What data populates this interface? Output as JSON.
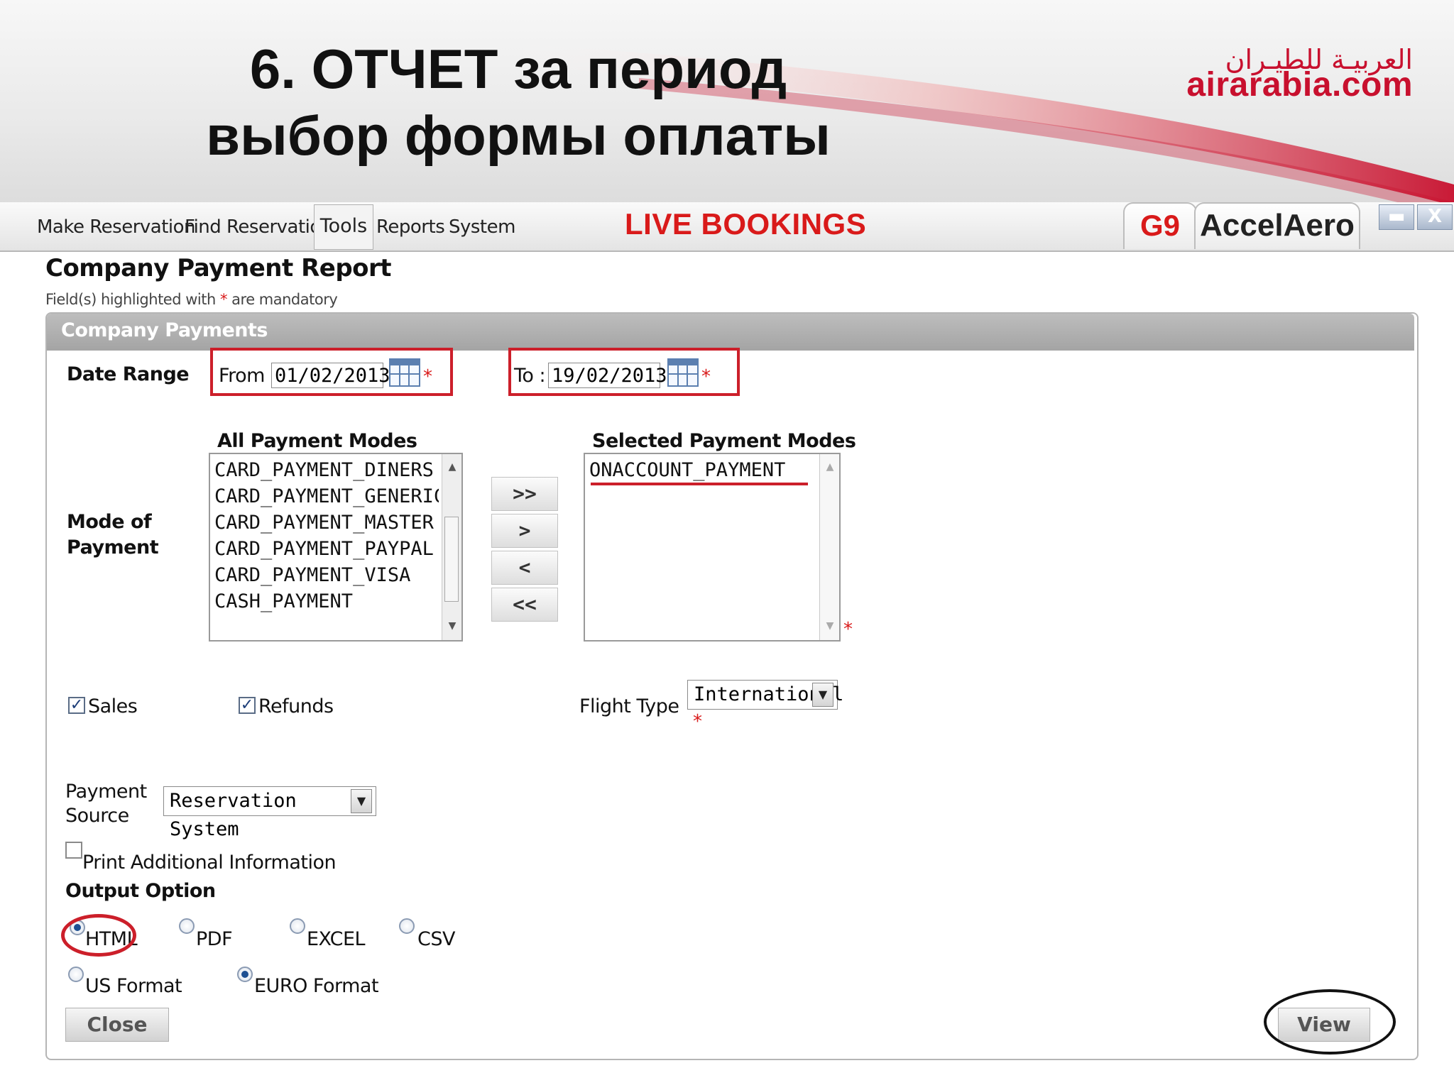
{
  "slide": {
    "title_line1": "6. ОТЧЕТ за период",
    "title_line2": "выбор формы оплаты",
    "logo_arabic": "العربيـة للطيـران",
    "logo_text": "airarabia.com"
  },
  "menu": {
    "items": [
      "Make Reservation",
      "Find Reservation",
      "Tools",
      "Reports",
      "System"
    ],
    "live_label": "LIVE BOOKINGS",
    "brand_tab1": "G9",
    "brand_tab2": "AccelAero",
    "minimize_label": "▬",
    "close_label": "X"
  },
  "page": {
    "title": "Company Payment Report",
    "mandatory_note_pre": "Field(s) highlighted with",
    "mandatory_star": "*",
    "mandatory_note_post": "are mandatory"
  },
  "panel": {
    "title": "Company Payments",
    "date_range_label": "Date Range",
    "from_label": "From :",
    "from_value": "01/02/2013",
    "to_label": "To :",
    "to_value": "19/02/2013",
    "required_star": "*",
    "mode_label_line1": "Mode of",
    "mode_label_line2": "Payment",
    "all_modes_header": "All Payment Modes",
    "all_modes": [
      "CARD_PAYMENT_DINERS",
      "CARD_PAYMENT_GENERIC",
      "CARD_PAYMENT_MASTER",
      "CARD_PAYMENT_PAYPAL",
      "CARD_PAYMENT_VISA",
      "CASH_PAYMENT"
    ],
    "selected_modes_header": "Selected Payment Modes",
    "selected_modes": [
      "ONACCOUNT_PAYMENT"
    ],
    "move_buttons": [
      ">>",
      ">",
      "<",
      "<<"
    ],
    "sales_label": "Sales",
    "sales_checked": true,
    "refunds_label": "Refunds",
    "refunds_checked": true,
    "flight_type_label": "Flight Type",
    "flight_type_value": "International",
    "payment_source_label_line1": "Payment",
    "payment_source_label_line2": "Source",
    "payment_source_value": "Reservation System",
    "print_additional_label": "Print Additional Information",
    "print_additional_checked": false,
    "output_option_label": "Output Option",
    "output_formats": [
      "HTML",
      "PDF",
      "EXCEL",
      "CSV"
    ],
    "output_selected": "HTML",
    "number_formats": [
      "US Format",
      "EURO Format"
    ],
    "number_selected": "EURO Format",
    "close_button": "Close",
    "view_button": "View"
  },
  "colors": {
    "accent_red": "#d91a1a",
    "annotation_red": "#cc1f2a",
    "panel_header_gray": "#a9a9a9"
  }
}
